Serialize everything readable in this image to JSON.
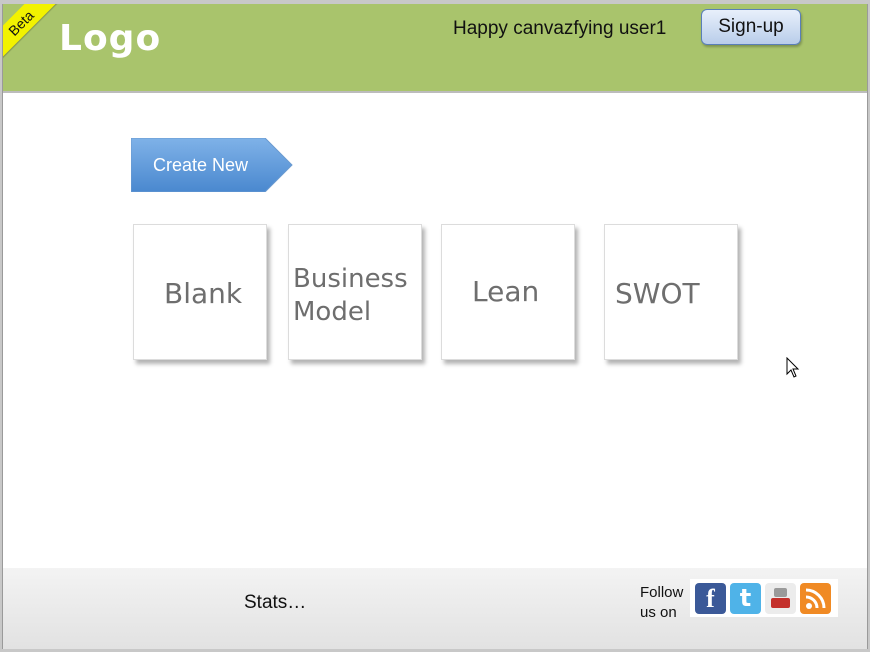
{
  "header": {
    "beta_label": "Beta",
    "logo_text": "Logo",
    "greeting": "Happy canvazfying user1",
    "signup_label": "Sign-up"
  },
  "main": {
    "create_new_label": "Create New",
    "templates": [
      {
        "label_line1": "Blank"
      },
      {
        "label_line1": "Business",
        "label_line2": "Model"
      },
      {
        "label_line1": "Lean"
      },
      {
        "label_line1": "SWOT"
      }
    ]
  },
  "footer": {
    "stats_label": "Stats…",
    "follow_line1": "Follow",
    "follow_line2": "us on",
    "social_icons": [
      "facebook-icon",
      "twitter-icon",
      "youtube-icon",
      "rss-icon"
    ]
  },
  "colors": {
    "header_bg": "#a9c46c",
    "beta_ribbon": "#f2f200",
    "create_new_button": "#5b9bd5",
    "facebook": "#3b5998",
    "twitter": "#4fb3e8",
    "youtube": "#c4302b",
    "rss": "#f08a24"
  }
}
